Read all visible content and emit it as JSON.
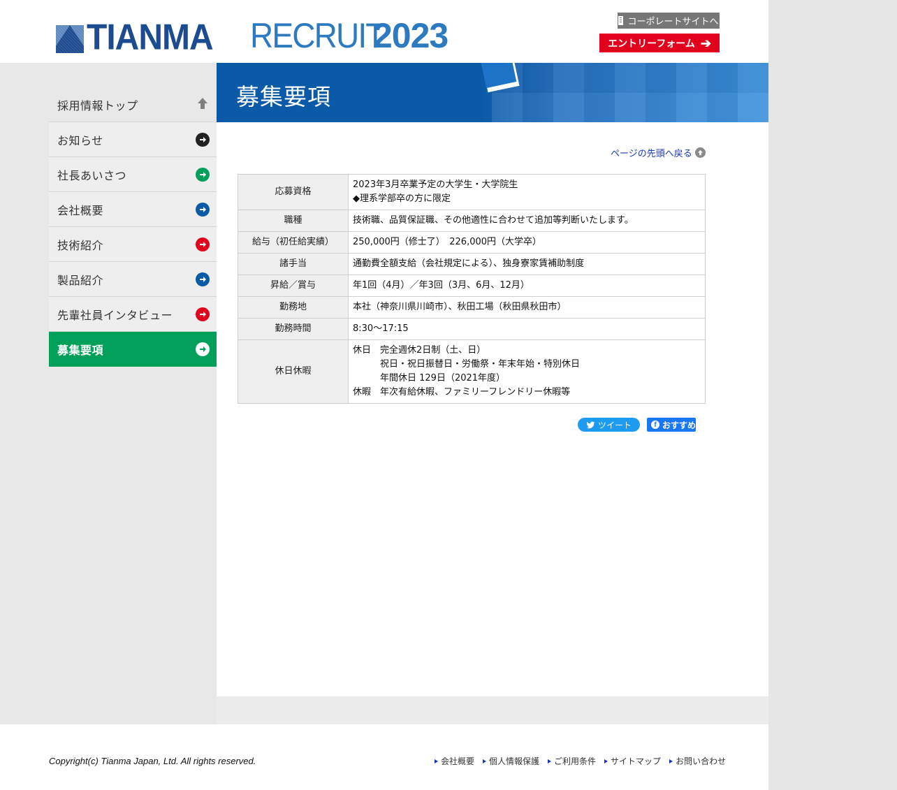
{
  "header": {
    "logo_text": "TIANMA",
    "recruit_word": "RECRUIT",
    "recruit_year": "2023",
    "corporate_link": "コーポレートサイトへ",
    "entry_form": "エントリーフォーム"
  },
  "banner": {
    "title": "募集要項"
  },
  "sidebar": {
    "items": [
      {
        "label": "採用情報トップ",
        "icon": "arrow-up-icon",
        "color": "#777777"
      },
      {
        "label": "お知らせ",
        "icon": "arrow-right-circle-icon",
        "color": "#222222"
      },
      {
        "label": "社長あいさつ",
        "icon": "arrow-right-circle-icon",
        "color": "#00a05a"
      },
      {
        "label": "会社概要",
        "icon": "arrow-right-circle-icon",
        "color": "#0a5aa8"
      },
      {
        "label": "技術紹介",
        "icon": "arrow-right-circle-icon",
        "color": "#e2001d"
      },
      {
        "label": "製品紹介",
        "icon": "arrow-right-circle-icon",
        "color": "#0a5aa8"
      },
      {
        "label": "先輩社員インタビュー",
        "icon": "arrow-right-circle-icon",
        "color": "#e2001d"
      },
      {
        "label": "募集要項",
        "icon": "arrow-right-circle-icon",
        "color": "#ffffff",
        "active": true
      }
    ]
  },
  "content": {
    "back_to_top": "ページの先頭へ戻る",
    "table": [
      {
        "header": "応募資格",
        "lines": [
          "2023年3月卒業予定の大学生・大学院生",
          "◆理系学部卒の方に限定"
        ]
      },
      {
        "header": "職種",
        "lines": [
          "技術職、品質保証職、その他適性に合わせて追加等判断いたします。"
        ]
      },
      {
        "header": "給与（初任給実績）",
        "lines": [
          "250,000円（修士了）　226,000円（大学卒）"
        ]
      },
      {
        "header": "諸手当",
        "lines": [
          "通勤費全額支給（会社規定による）、独身寮家賃補助制度"
        ]
      },
      {
        "header": "昇給／賞与",
        "lines": [
          "年1回（4月）／年3回（3月、6月、12月）"
        ]
      },
      {
        "header": "勤務地",
        "lines": [
          "本社（神奈川県川崎市）、秋田工場（秋田県秋田市）"
        ]
      },
      {
        "header": "勤務時間",
        "lines": [
          "8:30～17:15"
        ]
      },
      {
        "header": "休日休暇",
        "lines": [
          "休日　完全週休2日制（土、日）",
          "祝日・祝日振替日・労働祭・年末年始・特別休日",
          "年間休日 129日（2021年度）",
          "休暇　年次有給休暇、ファミリーフレンドリー休暇等"
        ]
      }
    ],
    "tweet_label": "ツイート",
    "fb_label": "おすすめ"
  },
  "footer": {
    "copyright": "Copyright(c) Tianma Japan, Ltd. All rights reserved.",
    "links": [
      "会社概要",
      "個人情報保護",
      "ご利用条件",
      "サイトマップ",
      "お問い合わせ"
    ]
  }
}
